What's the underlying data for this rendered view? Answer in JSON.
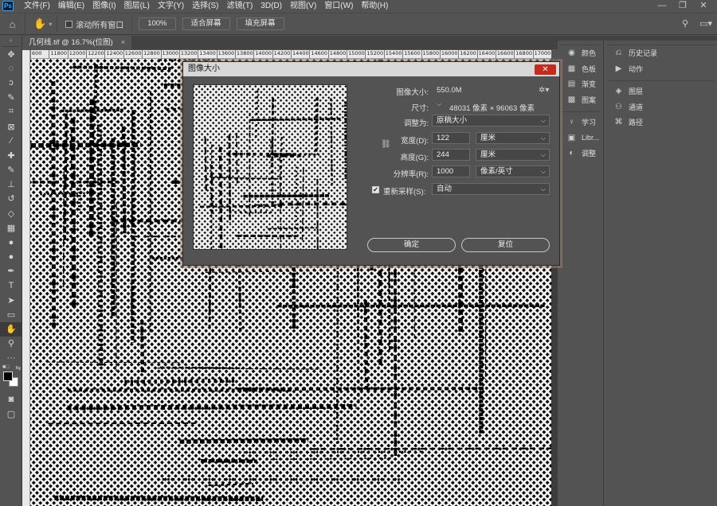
{
  "app": {
    "logo_text": "Ps"
  },
  "menu": [
    "文件(F)",
    "编辑(E)",
    "图像(I)",
    "图层(L)",
    "文字(Y)",
    "选择(S)",
    "滤镜(T)",
    "3D(D)",
    "视图(V)",
    "窗口(W)",
    "帮助(H)"
  ],
  "window_controls": {
    "minimize": "—",
    "restore": "❐",
    "close": "✕"
  },
  "options_bar": {
    "scroll_all_label": "滚动所有窗口",
    "zoom_value": "100%",
    "fit_screen_label": "适合屏幕",
    "fill_screen_label": "填充屏幕"
  },
  "document": {
    "tab_label": "几何线.tif @ 16.7%(位图)",
    "close": "×"
  },
  "ruler": {
    "ticks": [
      "600",
      "11800",
      "12000",
      "12200",
      "12400",
      "12600",
      "12800",
      "13000",
      "13200",
      "13400",
      "13600",
      "13800",
      "14000",
      "14200",
      "14400",
      "14600",
      "14800",
      "15000",
      "15200",
      "15400",
      "15600",
      "15800",
      "16000",
      "16200",
      "16400",
      "16600",
      "16800",
      "17000",
      "1"
    ]
  },
  "tools": [
    "move-icon",
    "marquee-icon",
    "lasso-icon",
    "quick-select-icon",
    "crop-icon",
    "frame-icon",
    "eyedropper-icon",
    "healing-icon",
    "brush-icon",
    "stamp-icon",
    "history-brush-icon",
    "eraser-icon",
    "gradient-icon",
    "blur-icon",
    "dodge-icon",
    "pen-icon",
    "type-icon",
    "path-select-icon",
    "rectangle-icon",
    "hand-icon",
    "zoom-icon",
    "more-tools-icon"
  ],
  "tool_glyphs": [
    "✥",
    "◌",
    "ↄ",
    "✎",
    "⌗",
    "⊠",
    "⁄",
    "✚",
    "✎",
    "⊥",
    "↺",
    "◇",
    "▦",
    "●",
    "●",
    "✒",
    "T",
    "➤",
    "▭",
    "✋",
    "⚲",
    "···"
  ],
  "active_tool": 19,
  "dialog": {
    "title": "图像大小",
    "close": "✕",
    "image_size_label": "图像大小:",
    "image_size_value": "550.0M",
    "dimensions_label": "尺寸:",
    "dimensions_value": "48031 像素  ×  96063 像素",
    "fit_to_label": "调整为:",
    "fit_to_value": "原稿大小",
    "width_label": "宽度(D):",
    "width_value": "122",
    "width_unit": "厘米",
    "height_label": "高度(G):",
    "height_value": "244",
    "height_unit": "厘米",
    "resolution_label": "分辨率(R):",
    "resolution_value": "1000",
    "resolution_unit": "像素/英寸",
    "resample_label": "重新采样(S):",
    "resample_value": "自动",
    "resample_checked": "✔",
    "ok_label": "确定",
    "cancel_label": "复位"
  },
  "panels": {
    "col1": [
      {
        "icon": "color-palette-icon",
        "glyph": "◉",
        "label": "颜色"
      },
      {
        "icon": "swatches-icon",
        "glyph": "▦",
        "label": "色板"
      },
      {
        "icon": "gradients-icon",
        "glyph": "▤",
        "label": "渐变"
      },
      {
        "icon": "patterns-icon",
        "glyph": "▩",
        "label": "图案"
      },
      {
        "icon": "learn-icon",
        "glyph": "♀",
        "label": "学习"
      },
      {
        "icon": "libraries-icon",
        "glyph": "▣",
        "label": "Libr..."
      },
      {
        "icon": "adjustments-icon",
        "glyph": "◐",
        "label": "调整"
      }
    ],
    "col2": [
      {
        "icon": "history-icon",
        "glyph": "⎌",
        "label": "历史记录"
      },
      {
        "icon": "actions-icon",
        "glyph": "▶",
        "label": "动作"
      },
      {
        "icon": "layers-icon",
        "glyph": "◈",
        "label": "图层"
      },
      {
        "icon": "channels-icon",
        "glyph": "⚇",
        "label": "通道"
      },
      {
        "icon": "paths-icon",
        "glyph": "⌘",
        "label": "路径"
      }
    ]
  }
}
